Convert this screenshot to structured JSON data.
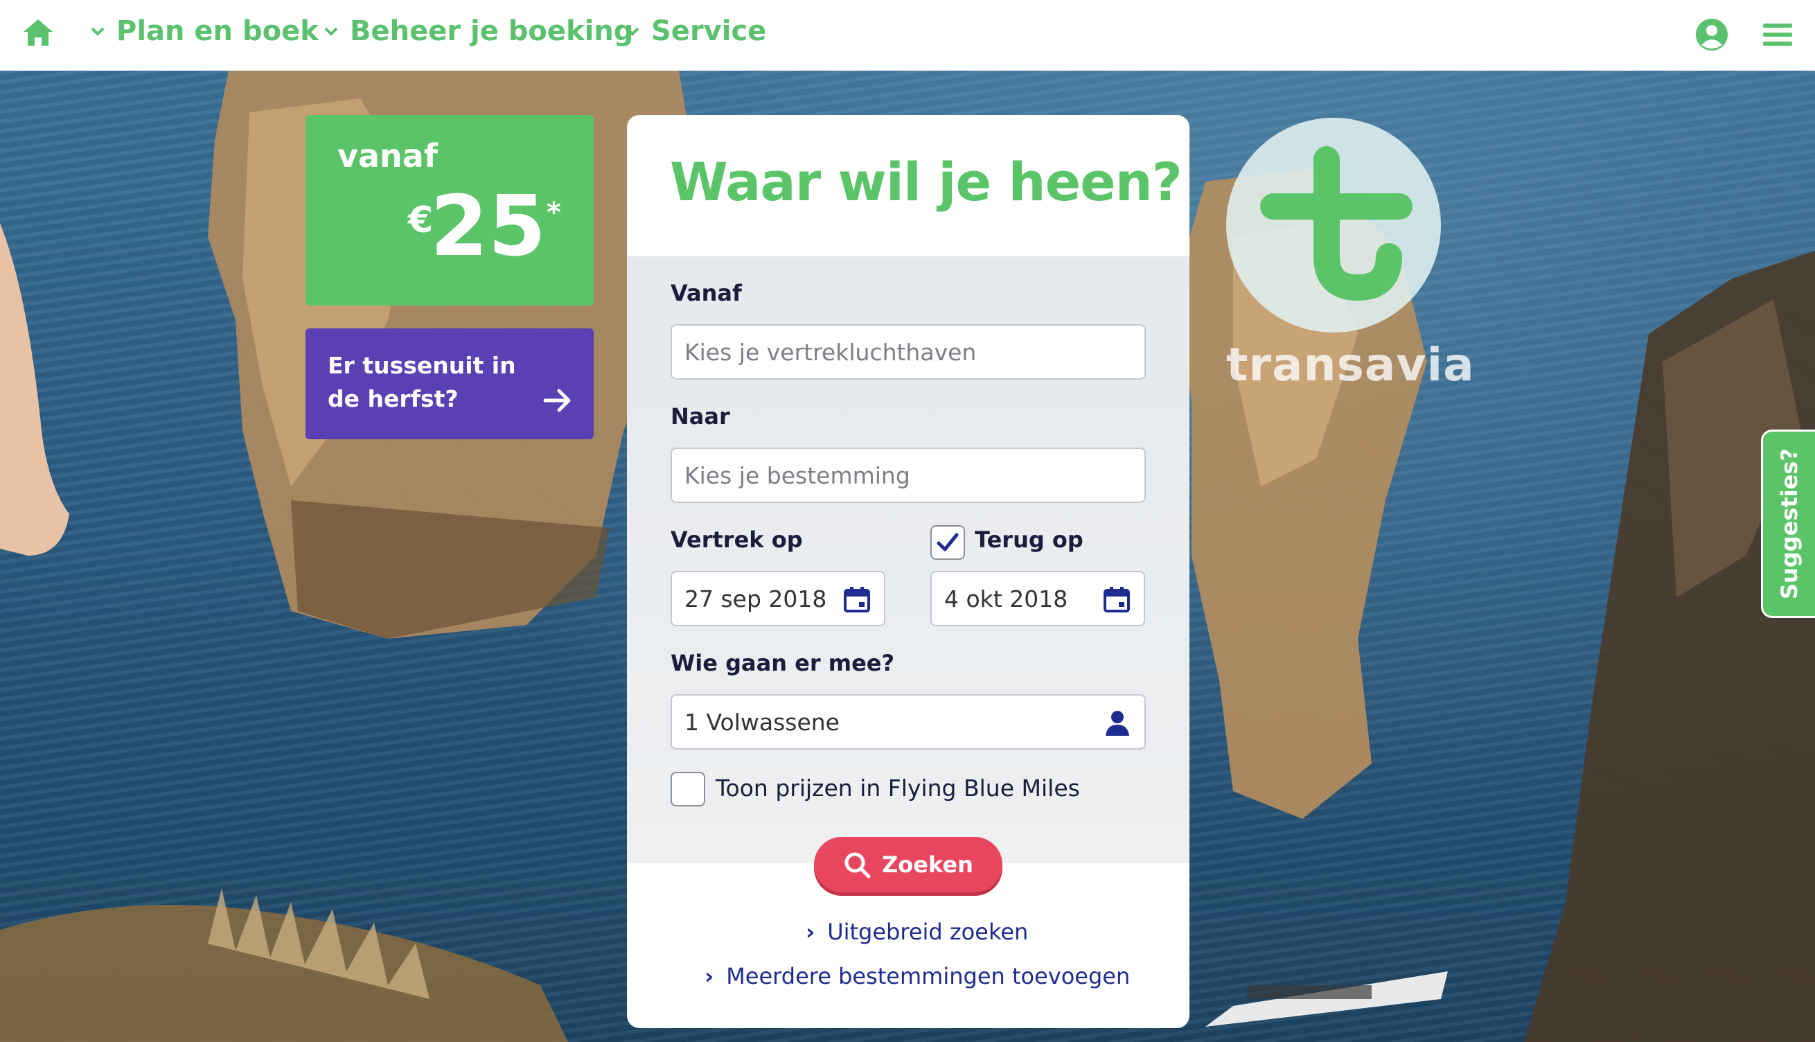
{
  "nav": {
    "items": [
      {
        "label": "Plan en boek"
      },
      {
        "label": "Beheer je boeking"
      },
      {
        "label": "Service"
      }
    ]
  },
  "promo": {
    "from_label": "vanaf",
    "currency": "€",
    "price": "25",
    "asterisk": "*",
    "autumn_label": "Er tussenuit in de herfst?"
  },
  "search": {
    "title": "Waar wil je heen?",
    "from_label": "Vanaf",
    "from_placeholder": "Kies je vertrekluchthaven",
    "to_label": "Naar",
    "to_placeholder": "Kies je bestemming",
    "depart_label": "Vertrek op",
    "depart_value": "27 sep 2018",
    "return_label": "Terug op",
    "return_checked": true,
    "return_value": "4 okt 2018",
    "pax_label": "Wie gaan er mee?",
    "pax_value": "1 Volwassene",
    "miles_label": "Toon prijzen in Flying Blue Miles",
    "miles_checked": false,
    "search_button": "Zoeken",
    "advanced_link": "Uitgebreid zoeken",
    "multi_link": "Meerdere bestemmingen toevoegen"
  },
  "brand": {
    "logo_text": "transavia",
    "primary_color": "#5bc468",
    "accent_color": "#e8465e",
    "promo_purple": "#5b40b3",
    "link_color": "#1f2c8f"
  },
  "suggestions_tab": "Suggesties?",
  "icons": {
    "home": "home-icon",
    "user": "user-circle-icon",
    "menu": "hamburger-menu-icon",
    "calendar": "calendar-icon",
    "person": "person-icon",
    "search": "search-icon",
    "arrow": "arrow-right-icon"
  }
}
